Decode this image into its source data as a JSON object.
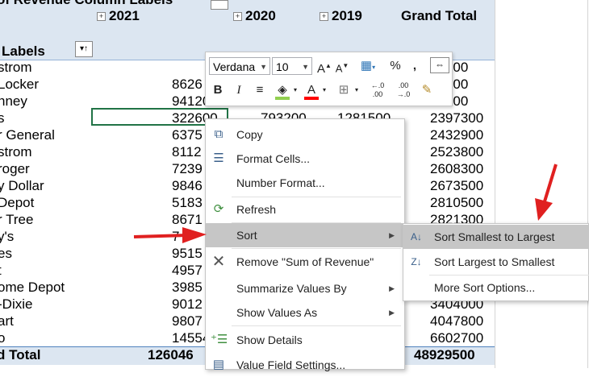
{
  "pivot": {
    "header_title": "of Revenue  Column Labels",
    "row_labels_header": "Labels",
    "years": [
      "2021",
      "2020",
      "2019"
    ],
    "grand_total_header": "Grand Total",
    "rows": [
      {
        "label": "strom",
        "v2021": "",
        "total": "31400"
      },
      {
        "label": "Locker",
        "v2021": "8626",
        "total": "57800"
      },
      {
        "label": "nney",
        "v2021": "941200",
        "total": "94400"
      },
      {
        "label": "s",
        "v2021": "322600",
        "v2020": "793200",
        "v2019": "1281500",
        "total": "2397300"
      },
      {
        "label": "r General",
        "v2021": "6375",
        "total": "2432900"
      },
      {
        "label": "strom",
        "v2021": "8112",
        "total": "2523800"
      },
      {
        "label": "roger",
        "v2021": "7239",
        "total": "2608300"
      },
      {
        "label": "y Dollar",
        "v2021": "9846",
        "total": "2673500"
      },
      {
        "label": " Depot",
        "v2021": "5183",
        "total": "2810500"
      },
      {
        "label": "r Tree",
        "v2021": "8671",
        "total": "2821300"
      },
      {
        "label": "y's",
        "v2021": "7",
        "total": ""
      },
      {
        "label": "es",
        "v2021": "9515",
        "total": ""
      },
      {
        "label": "t",
        "v2021": "4957",
        "total": ""
      },
      {
        "label": "ome Depot",
        "v2021": "3985",
        "total": ""
      },
      {
        "label": "-Dixie",
        "v2021": "9012",
        "total": "3404000"
      },
      {
        "label": "art",
        "v2021": "9807",
        "total": "4047800"
      },
      {
        "label": "o",
        "v2021": "14554",
        "total": "6602700"
      }
    ],
    "total_label": "d Total",
    "total_2021": "126046",
    "grand_total": "48929500"
  },
  "mini_toolbar": {
    "font_name": "Verdana",
    "font_size": "10",
    "bold": "B",
    "italic": "I",
    "font_color_letter": "A",
    "percent": "%",
    "comma": ",",
    "dec_inc": "←.0 .00",
    "dec_dec": ".00 →.0",
    "colors": {
      "fill": "#92d050",
      "font": "#ff0000"
    }
  },
  "context_menu": {
    "items": [
      {
        "label": "Copy",
        "icon": "copy-icon"
      },
      {
        "label": "Format Cells...",
        "icon": "format-cells-icon"
      },
      {
        "label": "Number Format...",
        "icon": ""
      },
      {
        "label": "Refresh",
        "icon": "refresh-icon"
      },
      {
        "label": "Sort",
        "icon": "",
        "has_submenu": true,
        "highlighted": true
      },
      {
        "label": "Remove \"Sum of Revenue\"",
        "icon": "remove-icon"
      },
      {
        "label": "Summarize Values By",
        "icon": "",
        "has_submenu": true
      },
      {
        "label": "Show Values As",
        "icon": "",
        "has_submenu": true
      },
      {
        "label": "Show Details",
        "icon": "show-details-icon"
      },
      {
        "label": "Value Field Settings...",
        "icon": ""
      }
    ],
    "sort_submenu": [
      {
        "label": "Sort Smallest to Largest",
        "icon": "sort-ascending-icon",
        "highlighted": true
      },
      {
        "label": "Sort Largest to Smallest",
        "icon": "sort-descending-icon"
      },
      {
        "label": "More Sort Options...",
        "icon": ""
      }
    ]
  },
  "annotation_color": "#e02020"
}
